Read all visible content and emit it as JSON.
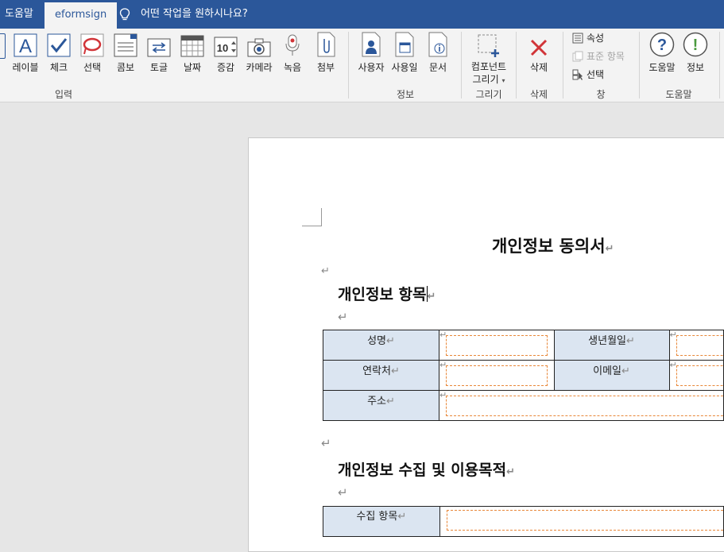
{
  "tabs": {
    "help": "도움말",
    "eformsign": "eformsign",
    "tell_me": "어떤 작업을 원하시나요?"
  },
  "ribbon": {
    "input": {
      "label_btn": "레이블",
      "check": "체크",
      "select": "선택",
      "combo": "콤보",
      "toggle": "토글",
      "date": "날짜",
      "stepper": "증감",
      "camera": "카메라",
      "record": "녹음",
      "attach": "첨부",
      "group": "입력"
    },
    "info": {
      "user": "사용자",
      "date": "사용일",
      "document": "문서",
      "group": "정보"
    },
    "draw": {
      "component_line1": "컴포넌트",
      "component_line2": "그리기",
      "group": "그리기"
    },
    "delete": {
      "delete": "삭제",
      "group": "삭제"
    },
    "window": {
      "properties": "속성",
      "standard_items": "표준 항목",
      "selection": "선택",
      "group": "창"
    },
    "help": {
      "help": "도움말",
      "info": "정보",
      "group": "도움말"
    }
  },
  "document": {
    "title": "개인정보 동의서",
    "section1": "개인정보 항목",
    "section2": "개인정보 수집 및 이용목적",
    "para_mark": "↵",
    "table1": {
      "name": "성명",
      "birth": "생년월일",
      "contact": "연락처",
      "email": "이메일",
      "address": "주소"
    },
    "table2": {
      "collect_items": "수집 항목"
    }
  },
  "colors": {
    "accent": "#2b579a",
    "label_cell": "#dbe5f1",
    "field_border": "#e8883a",
    "delete_icon": "#d13438"
  }
}
